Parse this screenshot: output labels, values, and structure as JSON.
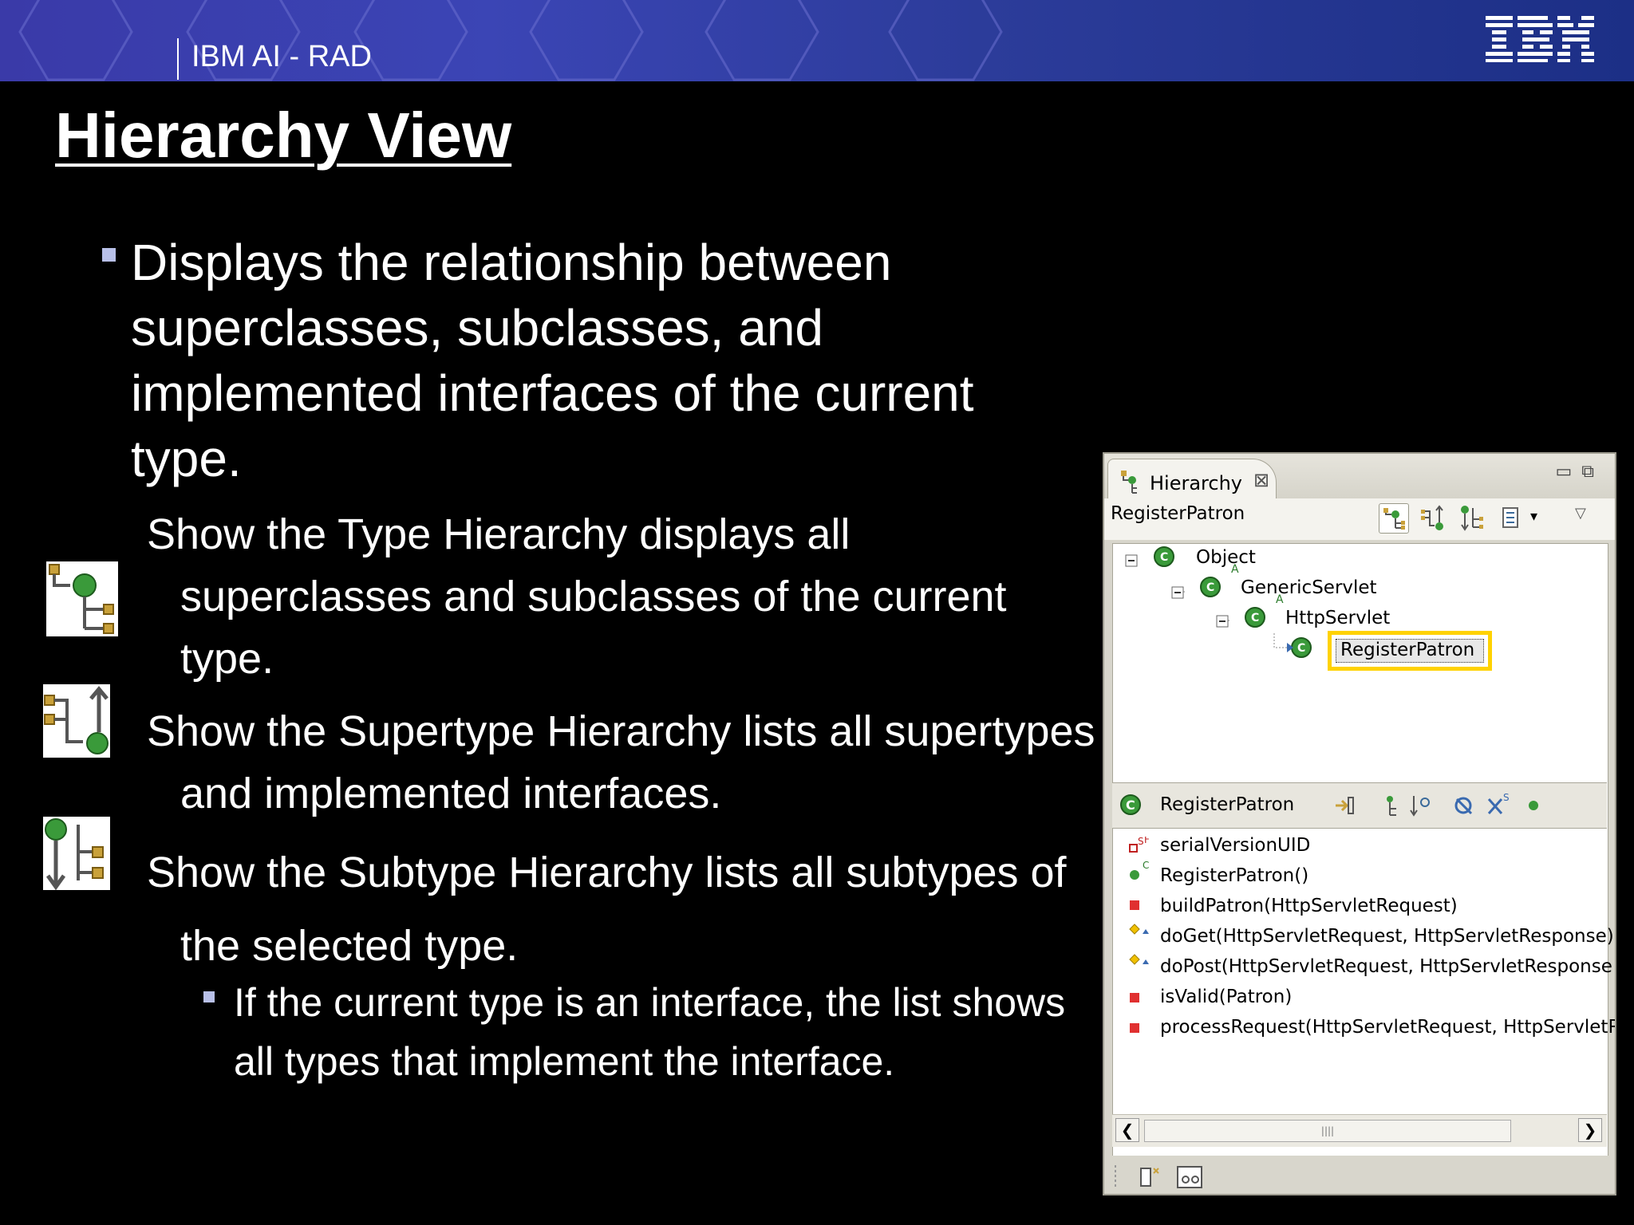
{
  "banner": {
    "title": "IBM AI - RAD",
    "logo_text": "IBM",
    "colors": {
      "left": "#3a3aa8",
      "right": "#1c2f86"
    }
  },
  "slide": {
    "title": "Hierarchy View",
    "main_bullet": "Displays the relationship between superclasses, subclasses, and implemented interfaces of the current type.",
    "items": [
      {
        "icon": "type-hierarchy-icon",
        "text": "Show the Type Hierarchy displays all superclasses and subclasses of the current type."
      },
      {
        "icon": "supertype-hierarchy-icon",
        "text": "Show the Supertype Hierarchy lists all supertypes and implemented interfaces."
      },
      {
        "icon": "subtype-hierarchy-icon",
        "text": "Show the Subtype Hierarchy lists all subtypes of the selected type."
      }
    ],
    "sub_bullet": "If the current type is an interface, the list shows all types that implement the interface."
  },
  "panel": {
    "tab_label": "Hierarchy",
    "type_name": "RegisterPatron",
    "tree": [
      {
        "label": "Object",
        "badge": ""
      },
      {
        "label": "GenericServlet",
        "badge": "A"
      },
      {
        "label": "HttpServlet",
        "badge": "A"
      },
      {
        "label": "RegisterPatron",
        "badge": "",
        "selected": true
      }
    ],
    "members_header": "RegisterPatron",
    "members": [
      {
        "label": "serialVersionUID",
        "badge": "S F",
        "icon": "static-final-field-icon"
      },
      {
        "label": "RegisterPatron()",
        "badge": "C",
        "icon": "public-constructor-icon"
      },
      {
        "label": "buildPatron(HttpServletRequest)",
        "badge": "",
        "icon": "private-method-icon"
      },
      {
        "label": "doGet(HttpServletRequest, HttpServletResponse)",
        "badge": "",
        "icon": "protected-method-icon"
      },
      {
        "label": "doPost(HttpServletRequest, HttpServletResponse",
        "badge": "",
        "icon": "protected-method-icon"
      },
      {
        "label": "isValid(Patron)",
        "badge": "",
        "icon": "private-method-icon"
      },
      {
        "label": "processRequest(HttpServletRequest, HttpServletR",
        "badge": "",
        "icon": "private-method-icon"
      }
    ],
    "highlight_color": "#ffd200"
  }
}
